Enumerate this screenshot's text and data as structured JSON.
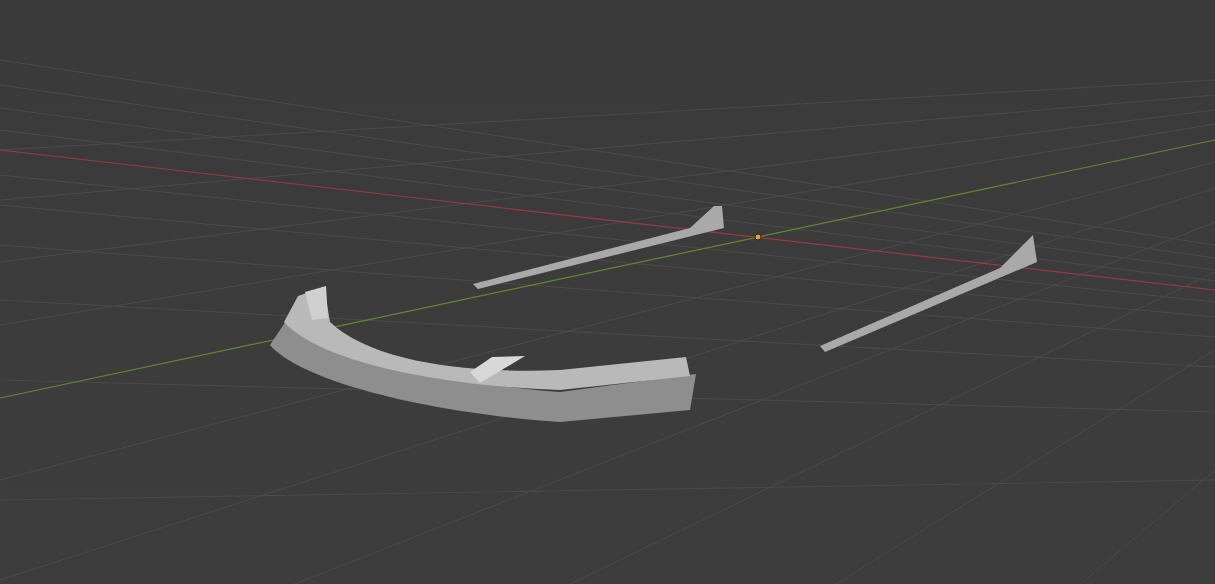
{
  "viewport": {
    "axes": [
      {
        "kind": "x",
        "color": "#9b3a3e"
      },
      {
        "kind": "y",
        "color": "#5f8a2c"
      }
    ]
  }
}
